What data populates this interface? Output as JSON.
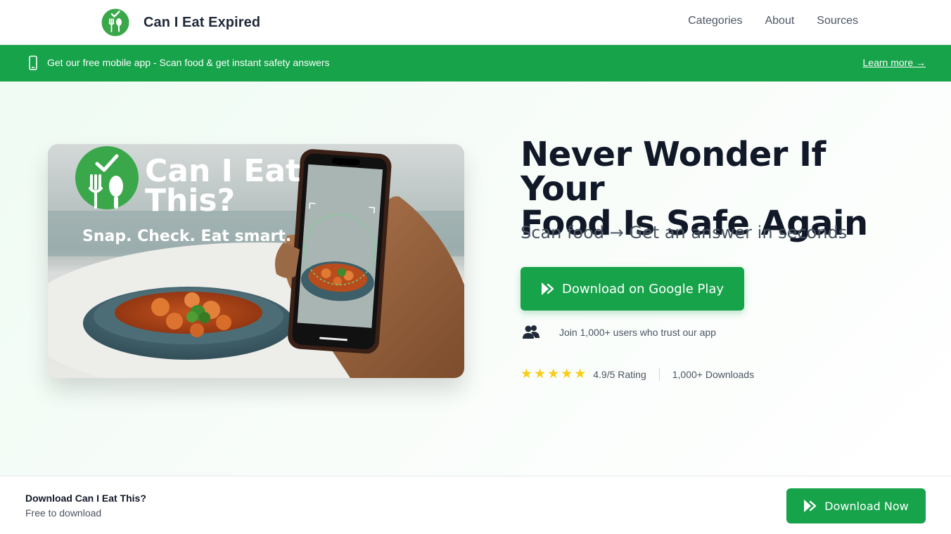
{
  "header": {
    "brand_name": "Can I Eat Expired",
    "nav": [
      "Categories",
      "About",
      "Sources"
    ]
  },
  "banner": {
    "text": "Get our free mobile app - Scan food & get instant safety answers",
    "link": "Learn more →"
  },
  "hero": {
    "image": {
      "app_name_line1": "Can I Eat",
      "app_name_line2": "This?",
      "tagline": "Snap. Check. Eat smart."
    },
    "title_line1": "Never Wonder If Your",
    "title_line2": "Food Is Safe Again",
    "subtitle": "Scan food → Get an answer in seconds",
    "cta_label": "Download on Google Play",
    "social_proof": "Join 1,000+ users who trust our app",
    "rating": {
      "stars": 5,
      "max": 5,
      "label": "4.9/5 Rating"
    },
    "downloads": "1,000+ Downloads"
  },
  "bottom_bar": {
    "title": "Download Can I Eat This?",
    "subtitle": "Free to download",
    "button_label": "Download Now"
  },
  "colors": {
    "brand_green": "#16a34a",
    "logo_green": "#3aa84a",
    "star": "#facc15",
    "title": "#111827"
  }
}
